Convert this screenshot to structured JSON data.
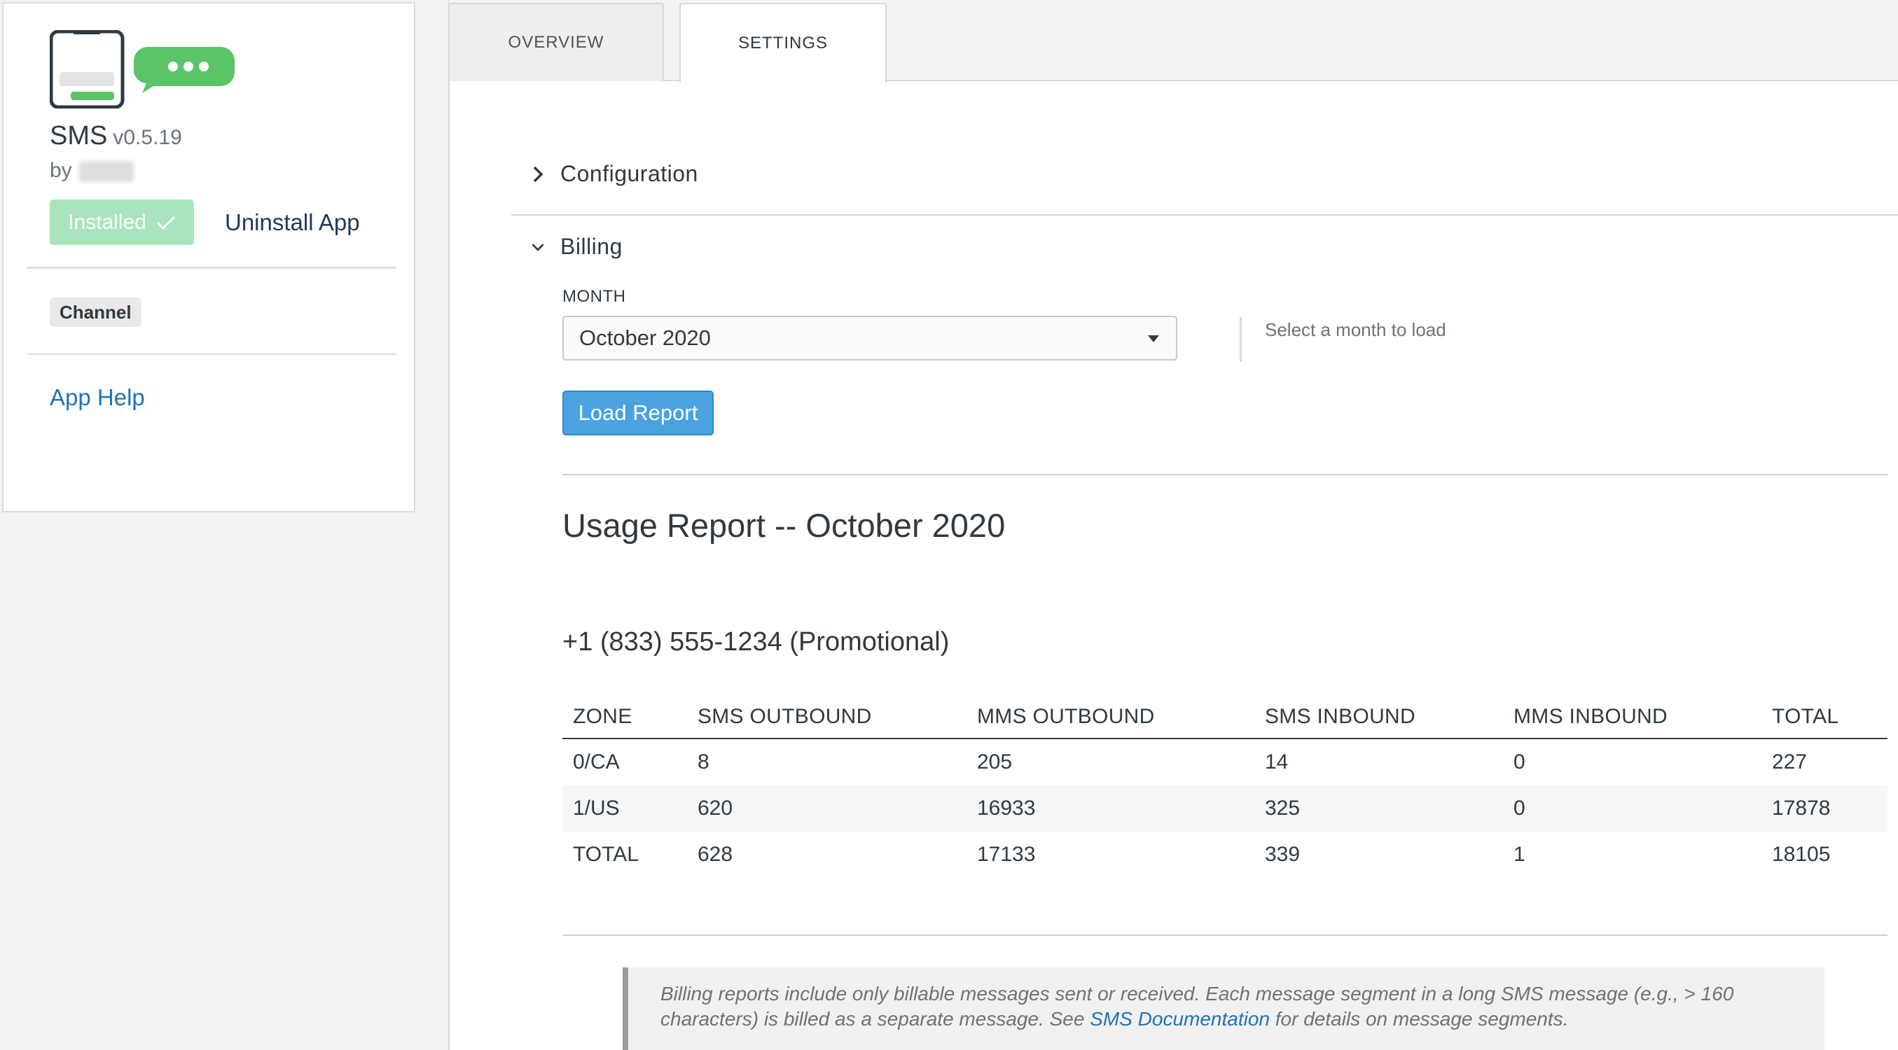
{
  "app": {
    "name": "SMS",
    "version": "v0.5.19",
    "by_label": "by",
    "installed_label": "Installed",
    "uninstall_label": "Uninstall App",
    "tag": "Channel",
    "help_label": "App Help"
  },
  "tabs": [
    {
      "label": "OVERVIEW"
    },
    {
      "label": "SETTINGS"
    }
  ],
  "sections": {
    "configuration": "Configuration",
    "billing": "Billing"
  },
  "billing": {
    "month_label": "MONTH",
    "month_value": "October 2020",
    "hint": "Select a month to load",
    "load_button": "Load Report"
  },
  "report": {
    "title": "Usage Report -- October 2020",
    "number_heading": "+1 (833) 555-1234 (Promotional)",
    "columns": [
      "ZONE",
      "SMS OUTBOUND",
      "MMS OUTBOUND",
      "SMS INBOUND",
      "MMS INBOUND",
      "TOTAL"
    ],
    "rows": [
      [
        "0/CA",
        "8",
        "205",
        "14",
        "0",
        "227"
      ],
      [
        "1/US",
        "620",
        "16933",
        "325",
        "0",
        "17878"
      ],
      [
        "TOTAL",
        "628",
        "17133",
        "339",
        "1",
        "18105"
      ]
    ]
  },
  "note": {
    "text_before": "Billing reports include only billable messages sent or received. Each message segment in a long SMS message (e.g., > 160 characters) is billed as a separate message. See ",
    "link": "SMS Documentation",
    "text_after": " for details on message segments."
  },
  "colors": {
    "brand_green": "#5ac467",
    "installed_bg": "#a9e4be",
    "link_blue": "#1f73b7",
    "button_blue": "#4aa3df"
  }
}
